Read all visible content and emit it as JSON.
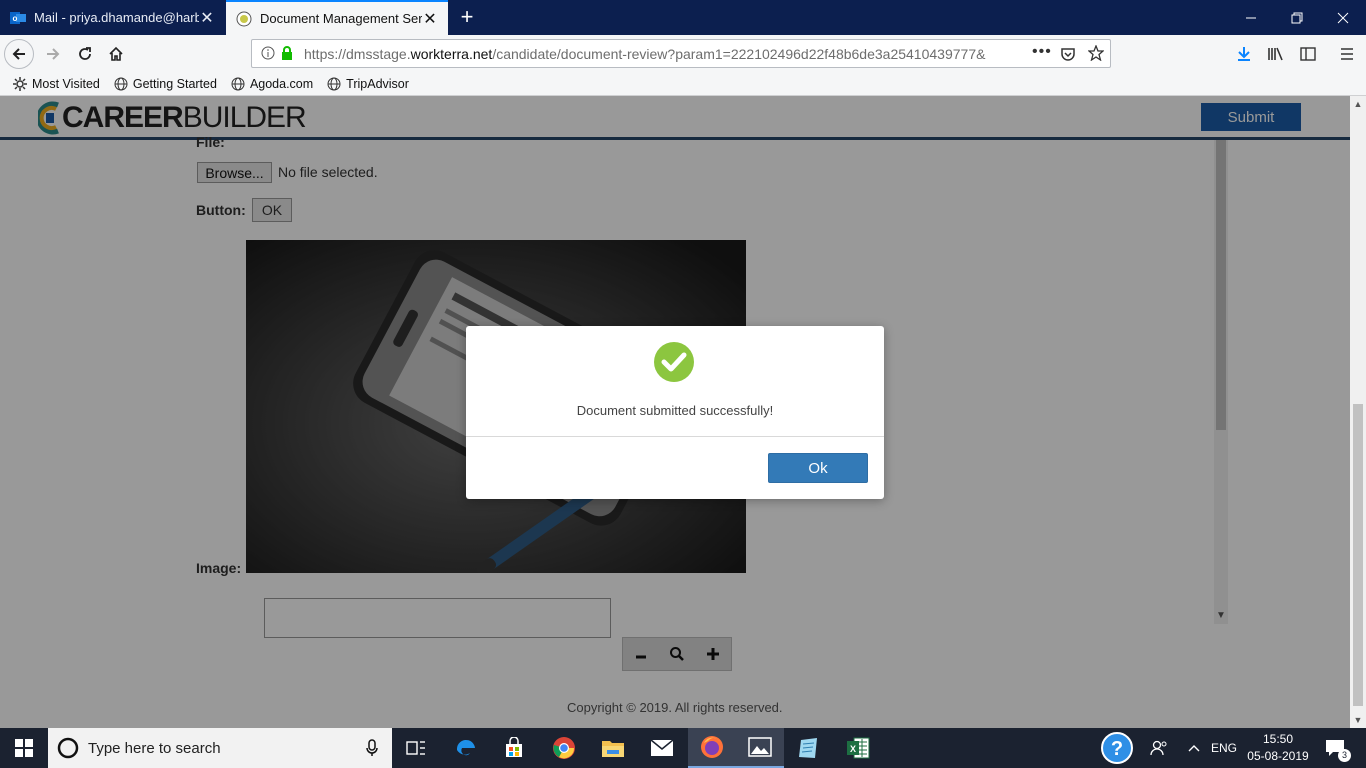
{
  "browser": {
    "tabs": [
      {
        "title": "Mail - priya.dhamande@harbin"
      },
      {
        "title": "Document Management Servic"
      }
    ],
    "url_prefix": "https://dmsstage.",
    "url_domain": "workterra.net",
    "url_path": "/candidate/document-review?param1=222102496d22f48b6de3a25410439777&",
    "bookmarks": [
      "Most Visited",
      "Getting Started",
      "Agoda.com",
      "TripAdvisor"
    ]
  },
  "header": {
    "logo_bold": "CAREER",
    "logo_light": "BUILDER",
    "submit_label": "Submit"
  },
  "form": {
    "file_label": "File:",
    "browse_label": "Browse...",
    "no_file_text": "No file selected.",
    "button_label": "Button:",
    "ok_label": "OK",
    "image_label": "Image:"
  },
  "footer": {
    "copyright": "Copyright © 2019. All rights reserved."
  },
  "modal": {
    "message": "Document submitted successfully!",
    "ok_label": "Ok"
  },
  "taskbar": {
    "search_placeholder": "Type here to search",
    "language": "ENG",
    "time": "15:50",
    "date": "05-08-2019",
    "notification_count": "3"
  },
  "colors": {
    "tabbar": "#0c1f4f",
    "accent_blue": "#1c5da8",
    "success_green": "#8cc63f",
    "modal_button": "#337ab7"
  }
}
